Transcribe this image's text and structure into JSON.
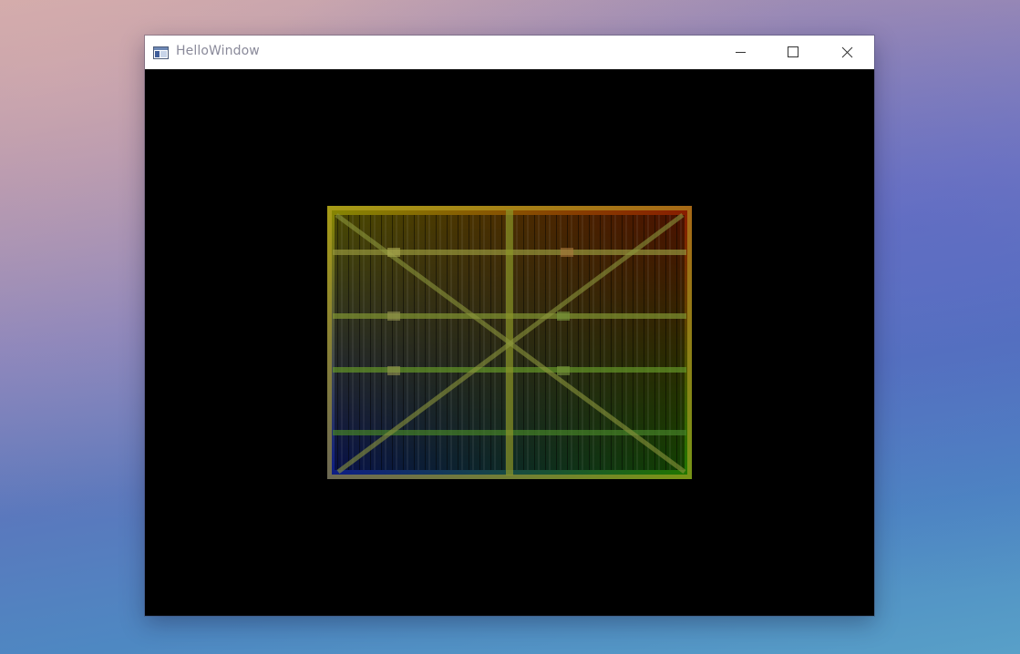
{
  "window": {
    "title": "HelloWindow",
    "controls": {
      "minimize_icon": "minimize-icon",
      "maximize_icon": "maximize-icon",
      "close_icon": "close-icon"
    }
  },
  "scene": {
    "object": "textured-quad",
    "texture": "wooden-container",
    "vertex_colors": {
      "top_left": "#ffff00",
      "top_right": "#ff0000",
      "bottom_left": "#0000ff",
      "bottom_right": "#00ff00"
    },
    "background_color": "#000000"
  },
  "colors": {
    "titlebar": "#ffffff",
    "title_text": "#8a8a9a"
  }
}
